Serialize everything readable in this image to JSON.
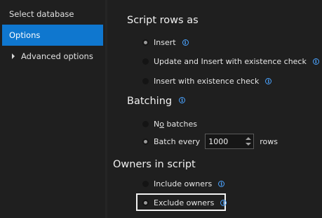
{
  "sidebar": {
    "items": [
      {
        "label": "Select database"
      },
      {
        "label": "Options"
      },
      {
        "label": "Advanced options"
      }
    ]
  },
  "script_rows": {
    "heading": "Script rows as",
    "options": [
      {
        "label": "Insert",
        "checked": true
      },
      {
        "label": "Update and Insert with existence check",
        "checked": false
      },
      {
        "label": "Insert with existence check",
        "checked": false
      }
    ]
  },
  "batching": {
    "heading": "Batching",
    "no_batches": {
      "prefix": "N",
      "accel": "o",
      "rest": " batches"
    },
    "batch_every_label": "Batch every",
    "batch_size": "1000",
    "rows_label": "rows"
  },
  "owners": {
    "heading": "Owners in script",
    "options": [
      {
        "label": "Include owners",
        "checked": false
      },
      {
        "label": "Exclude owners",
        "checked": true
      }
    ]
  },
  "icons": {
    "info": "info-icon",
    "radio": "radio-button",
    "expand": "chevron-right-icon"
  },
  "colors": {
    "background": "#1f1f1f",
    "accent": "#0f77cf",
    "info": "#4aa3ff"
  }
}
